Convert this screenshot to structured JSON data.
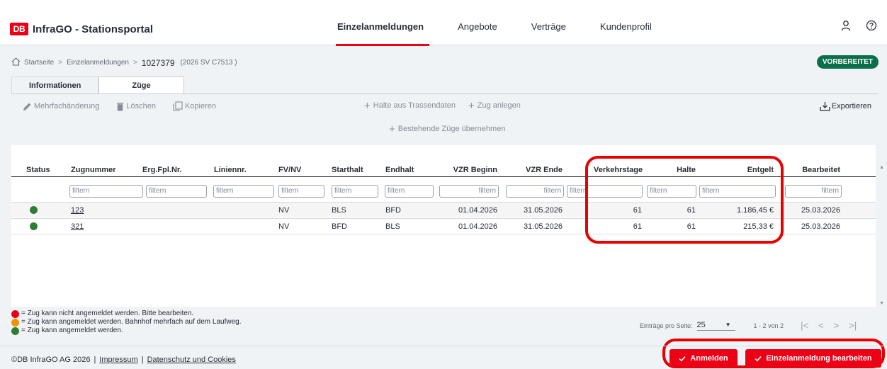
{
  "header": {
    "logo_text": "DB",
    "app_title": "InfraGO - Stationsportal",
    "nav": [
      {
        "label": "Einzelanmeldungen"
      },
      {
        "label": "Angebote"
      },
      {
        "label": "Verträge"
      },
      {
        "label": "Kundenprofil"
      }
    ],
    "active_nav": "Einzelanmeldungen"
  },
  "breadcrumb": {
    "home": "Startseite",
    "level1": "Einzelanmeldungen",
    "current": "1027379",
    "sub": "(2026 SV C7513 )"
  },
  "status_badge": "VORBEREITET",
  "tabs": [
    {
      "label": "Informationen"
    },
    {
      "label": "Züge"
    }
  ],
  "active_tab": "Züge",
  "toolbar": {
    "multi_edit": "Mehrfachänderung",
    "delete": "Löschen",
    "copy": "Kopieren",
    "stops_from_path": "Halte aus Trassendaten",
    "add_train": "Zug anlegen",
    "take_existing": "Bestehende Züge übernehmen",
    "export": "Exportieren"
  },
  "table": {
    "columns": [
      "Status",
      "Zugnummer",
      "Erg.Fpl.Nr.",
      "Liniennr.",
      "FV/NV",
      "Starthalt",
      "Endhalt",
      "VZR Beginn",
      "VZR Ende",
      "Verkehrstage",
      "Halte",
      "Entgelt",
      "Bearbeitet"
    ],
    "filter_placeholder": "filtern",
    "rows": [
      {
        "status": "green",
        "zugnummer": "123",
        "ergfpl": "",
        "linie": "",
        "fvnv": "NV",
        "start": "BLS",
        "end": "BFD",
        "vzr_begin": "01.04.2026",
        "vzr_end": "31.05.2026",
        "verkehrstage": "61",
        "halte": "61",
        "entgelt": "1.186,45 €",
        "bearbeitet": "25.03.2026"
      },
      {
        "status": "green",
        "zugnummer": "321",
        "ergfpl": "",
        "linie": "",
        "fvnv": "NV",
        "start": "BFD",
        "end": "BLS",
        "vzr_begin": "01.04.2026",
        "vzr_end": "31.05.2026",
        "verkehrstage": "61",
        "halte": "61",
        "entgelt": "215,33 €",
        "bearbeitet": "25.03.2026"
      }
    ]
  },
  "legend": [
    {
      "color": "#ec0016",
      "text": "= Zug kann nicht angemeldet werden. Bitte bearbeiten."
    },
    {
      "color": "#f39200",
      "text": "= Zug kann angemeldet werden. Bahnhof mehrfach auf dem Laufweg."
    },
    {
      "color": "#2e7d32",
      "text": "= Zug kann angemeldet werden."
    }
  ],
  "pagination": {
    "per_page_label": "Einträge pro Seite:",
    "per_page_value": "25",
    "range": "1 - 2 von 2"
  },
  "footer": {
    "copyright": "©DB InfraGO AG 2026",
    "impressum": "Impressum",
    "privacy": "Datenschutz und Cookies"
  },
  "actions": {
    "register": "Anmelden",
    "edit": "Einzelanmeldung bearbeiten"
  },
  "colors": {
    "accent": "#ec0016",
    "status_green": "#2e7d32",
    "badge": "#0a6e4a"
  }
}
